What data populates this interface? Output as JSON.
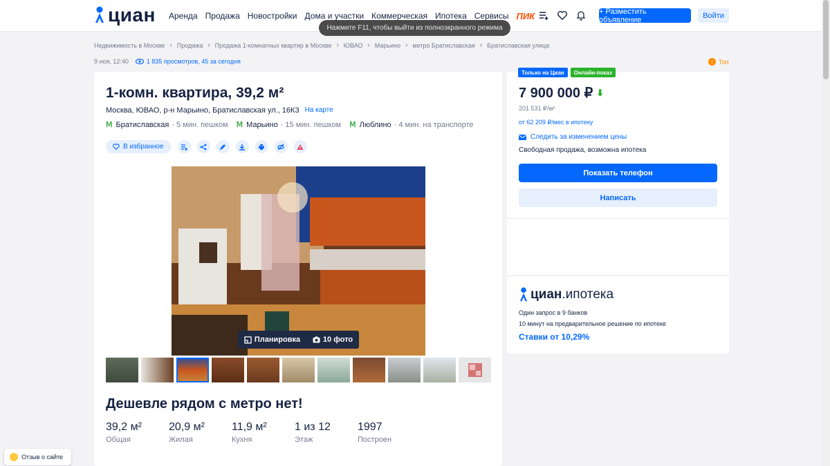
{
  "header": {
    "logo_text": "циан",
    "nav": [
      "Аренда",
      "Продажа",
      "Новостройки",
      "Дома и участки",
      "Коммерческая",
      "Ипотека",
      "Сервисы"
    ],
    "nav_special": "ПИК",
    "place_ad": "+ Разместить объявление",
    "login": "Войти",
    "icons": [
      "compare-icon",
      "heart-icon",
      "bell-icon"
    ]
  },
  "toast": "Нажмите F11, чтобы выйти из полноэкранного режима",
  "breadcrumbs": [
    "Недвижимость в Москве",
    "Продажа",
    "Продажа 1-комнатных квартир в Москве",
    "ЮВАО",
    "Марьино",
    "метро Братиславская",
    "Братиславская улица"
  ],
  "meta": {
    "date": "9 ноя, 12:40",
    "views": "1 835 просмотров, 45 за сегодня",
    "top": "Топ"
  },
  "listing": {
    "title": "1-комн. квартира, 39,2 м²",
    "address": "Москва, ЮВАО, р-н Марьино, Братиславская ул., 16К3",
    "on_map": "На карте",
    "metro": [
      {
        "name": "Братиславская",
        "dist": "· 5 мин. пешком"
      },
      {
        "name": "Марьино",
        "dist": "· 15 мин. пешком"
      },
      {
        "name": "Люблино",
        "dist": "· 4 мин. на транспорте"
      }
    ],
    "fav": "В избранное",
    "action_icons": [
      "compare-icon",
      "share-icon",
      "edit-icon",
      "download-icon",
      "print-icon",
      "hide-icon",
      "report-icon"
    ],
    "photo_plan": "Планировка",
    "photo_count": "10 фото",
    "subtitle": "Дешевле рядом с метро нет!",
    "facts": [
      {
        "value": "39,2 м²",
        "label": "Общая"
      },
      {
        "value": "20,9 м²",
        "label": "Жилая"
      },
      {
        "value": "11,9 м²",
        "label": "Кухня"
      },
      {
        "value": "1 из 12",
        "label": "Этаж"
      },
      {
        "value": "1997",
        "label": "Построен"
      }
    ]
  },
  "side": {
    "badge_only": "Только на Циан",
    "badge_online": "Онлайн-показ",
    "price": "7 900 000 ₽",
    "price_per_m": "201 531 ₽/м²",
    "mortgage": "от 62 209 ₽/мес в ипотеку",
    "follow": "Следить за изменением цены",
    "free_sale": "Свободная продажа, возможна ипотека",
    "phone_btn": "Показать телефон",
    "write_btn": "Написать",
    "ipo_brand": "циан",
    "ipo_word": ".ипотека",
    "ipo_line1": "Один запрос в 9 банков",
    "ipo_line2": "10 минут на предварительное решение по ипотеке",
    "ipo_rate": "Ставки от 10,29%"
  },
  "feedback": "Отзыв о сайте",
  "colors": {
    "accent": "#0468ff",
    "text": "#152242",
    "muted": "#737a8e",
    "green": "#2cb22c",
    "pik": "#ff4f00"
  }
}
